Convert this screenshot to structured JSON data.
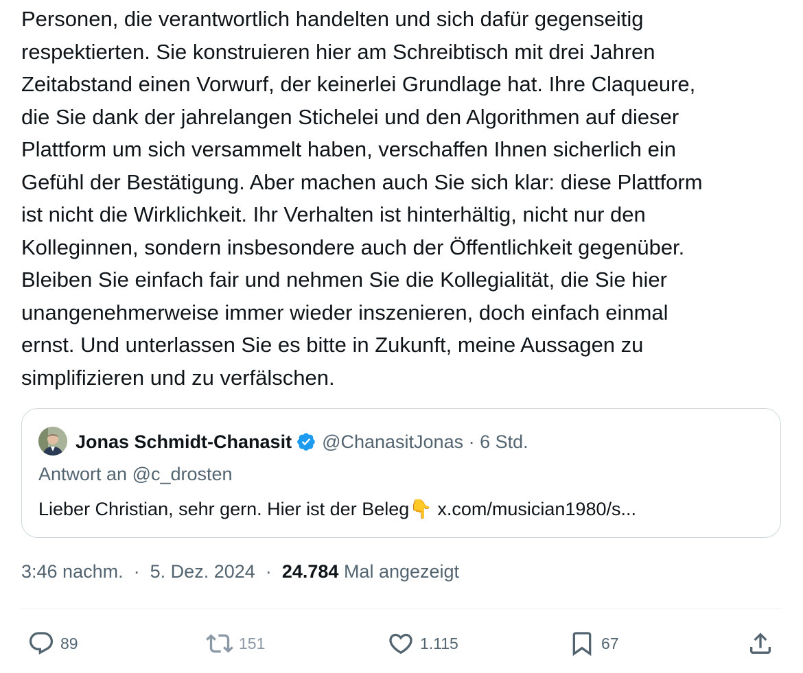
{
  "tweet": {
    "text_lines": [
      "Personen, die verantwortlich handelten und sich dafür gegenseitig",
      "respektierten. Sie konstruieren hier am Schreibtisch mit drei Jahren",
      "Zeitabstand einen Vorwurf, der keinerlei Grundlage hat. Ihre Claqueure,",
      "die Sie dank der jahrelangen Stichelei und den Algorithmen auf dieser",
      "Plattform um sich versammelt haben, verschaffen Ihnen sicherlich ein",
      "Gefühl der Bestätigung. Aber machen auch Sie sich klar: diese Plattform",
      "ist nicht die Wirklichkeit. Ihr Verhalten ist hinterhältig, nicht nur den",
      "Kolleginnen, sondern insbesondere auch der Öffentlichkeit gegenüber.",
      "Bleiben Sie einfach fair und nehmen Sie die Kollegialität, die Sie hier",
      "unangenehmerweise immer wieder inszenieren, doch einfach einmal",
      "ernst. Und unterlassen Sie es bitte in Zukunft, meine Aussagen zu",
      "simplifizieren und zu verfälschen."
    ]
  },
  "quote": {
    "author_name": "Jonas Schmidt-Chanasit",
    "handle": "@ChanasitJonas",
    "separator": "·",
    "time": "6 Std.",
    "reply_to": "Antwort an @c_drosten",
    "text": "Lieber Christian, sehr gern. Hier ist der Beleg👇 x.com/musician1980/s..."
  },
  "meta": {
    "time": "3:46 nachm.",
    "separator": "·",
    "date": "5. Dez. 2024",
    "views_count": "24.784",
    "views_label": "Mal angezeigt"
  },
  "actions": {
    "replies": "89",
    "retweets": "151",
    "likes": "1.115",
    "bookmarks": "67"
  },
  "icons": {
    "verified": "verified-badge-icon",
    "reply": "reply-icon",
    "retweet": "retweet-icon",
    "like": "heart-icon",
    "bookmark": "bookmark-icon",
    "share": "share-icon"
  },
  "colors": {
    "verified_blue": "#1d9bf0",
    "muted_text": "#536471",
    "border": "#cfd9de"
  }
}
